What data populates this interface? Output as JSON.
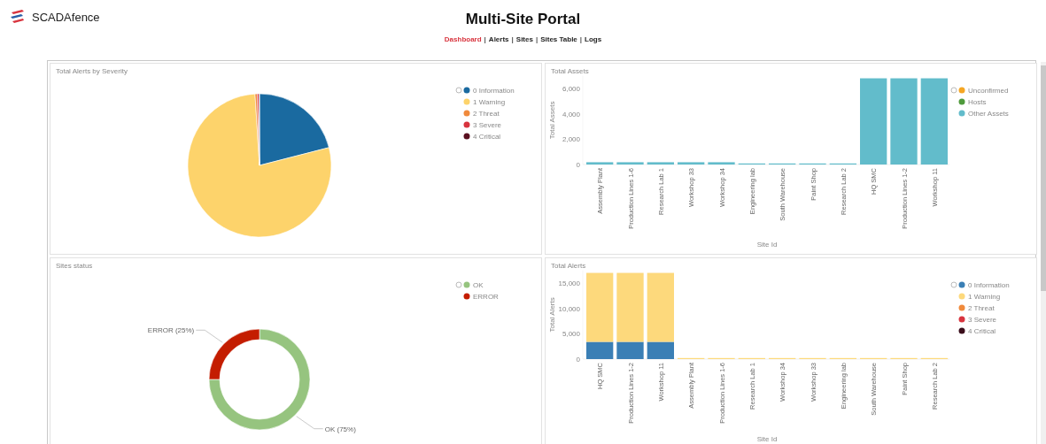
{
  "header": {
    "logo_text": "SCADAfence",
    "title": "Multi-Site Portal"
  },
  "nav": {
    "separator": "|",
    "items": [
      {
        "label": "Dashboard",
        "selected": true
      },
      {
        "label": "Alerts",
        "selected": false
      },
      {
        "label": "Sites",
        "selected": false
      },
      {
        "label": "Sites Table",
        "selected": false
      },
      {
        "label": "Logs",
        "selected": false
      }
    ]
  },
  "panels": [
    {
      "title": "Total Alerts by Severity",
      "slices": [
        {
          "color": "#1a6aa0"
        },
        {
          "color": "#fdd36b"
        },
        {
          "color": "#f08a3c"
        },
        {
          "color": "#d8343e"
        },
        {
          "color": "#5a1020"
        }
      ],
      "chart_data": {
        "type": "pie",
        "legend": "right",
        "categories": [
          "0 Information",
          "1 Warning",
          "2 Threat",
          "3 Severe",
          "4 Critical"
        ],
        "values": [
          21,
          78,
          0.5,
          0.4,
          0.1
        ]
      }
    },
    {
      "title": "Total Assets",
      "chart_data": {
        "type": "bar",
        "legend": "right",
        "stacked": true,
        "xlabel": "Site Id",
        "ylabel": "Total Assets",
        "ylim": [
          0,
          7000
        ],
        "yticks": [
          {
            "value": 0,
            "label": "0"
          },
          {
            "value": 2000,
            "label": "2,000"
          },
          {
            "value": 4000,
            "label": "4,000"
          },
          {
            "value": 6000,
            "label": "6,000"
          }
        ],
        "categories": [
          "Assembly Plant",
          "Production Lines 1-6",
          "Research Lab 1",
          "Workshop 33",
          "Workshop 34",
          "Engineering lab",
          "South Warehouse",
          "Paint Shop",
          "Research Lab 2",
          "HQ SMC",
          "Production Lines 1-2",
          "Workshop 11"
        ],
        "series": [
          {
            "name": "Unconfirmed",
            "color": "#f5a623",
            "values": [
              0,
              0,
              0,
              0,
              0,
              0,
              0,
              0,
              0,
              0,
              0,
              0
            ]
          },
          {
            "name": "Hosts",
            "color": "#4f9a3c",
            "values": [
              0,
              0,
              0,
              0,
              0,
              0,
              0,
              0,
              0,
              0,
              0,
              0
            ]
          },
          {
            "name": "Other Assets",
            "color": "#62bccb",
            "values": [
              180,
              180,
              180,
              180,
              180,
              60,
              60,
              60,
              60,
              6800,
              6800,
              6800
            ]
          }
        ]
      }
    },
    {
      "title": "Sites status",
      "slices": [
        {
          "color": "#96c47f"
        },
        {
          "color": "#c41d00"
        }
      ],
      "chart_data": {
        "type": "donut",
        "legend": "right",
        "categories": [
          "OK",
          "ERROR"
        ],
        "values": [
          75,
          25
        ],
        "annotations": [
          {
            "text": "OK (75%)"
          },
          {
            "text": "ERROR (25%)"
          }
        ]
      }
    },
    {
      "title": "Total Alerts",
      "chart_data": {
        "type": "bar",
        "legend": "right",
        "stacked": true,
        "xlabel": "Site Id",
        "ylabel": "Total Alerts",
        "ylim": [
          0,
          17500
        ],
        "yticks": [
          {
            "value": 0,
            "label": "0"
          },
          {
            "value": 5000,
            "label": "5,000"
          },
          {
            "value": 10000,
            "label": "10,000"
          },
          {
            "value": 15000,
            "label": "15,000"
          }
        ],
        "categories": [
          "HQ SMC",
          "Production Lines 1-2",
          "Workshop 11",
          "Assembly Plant",
          "Production Lines 1-6",
          "Research Lab 1",
          "Workshop 34",
          "Workshop 33",
          "Engineering lab",
          "South Warehouse",
          "Paint Shop",
          "Research Lab 2"
        ],
        "series": [
          {
            "name": "0 Information",
            "color": "#3a7fb5",
            "values": [
              3400,
              3400,
              3400,
              0,
              0,
              0,
              0,
              0,
              0,
              0,
              0,
              0
            ]
          },
          {
            "name": "1 Warning",
            "color": "#fdd97c",
            "values": [
              13600,
              13600,
              13600,
              200,
              200,
              200,
              200,
              200,
              100,
              100,
              100,
              100
            ]
          },
          {
            "name": "2 Threat",
            "color": "#f08a3c",
            "values": [
              0,
              0,
              0,
              0,
              0,
              0,
              0,
              0,
              0,
              0,
              0,
              0
            ]
          },
          {
            "name": "3 Severe",
            "color": "#d8343e",
            "values": [
              0,
              0,
              0,
              0,
              0,
              0,
              0,
              0,
              0,
              0,
              0,
              0
            ]
          },
          {
            "name": "4 Critical",
            "color": "#3a0d1a",
            "values": [
              0,
              0,
              0,
              0,
              0,
              0,
              0,
              0,
              0,
              0,
              0,
              0
            ]
          }
        ]
      }
    }
  ]
}
